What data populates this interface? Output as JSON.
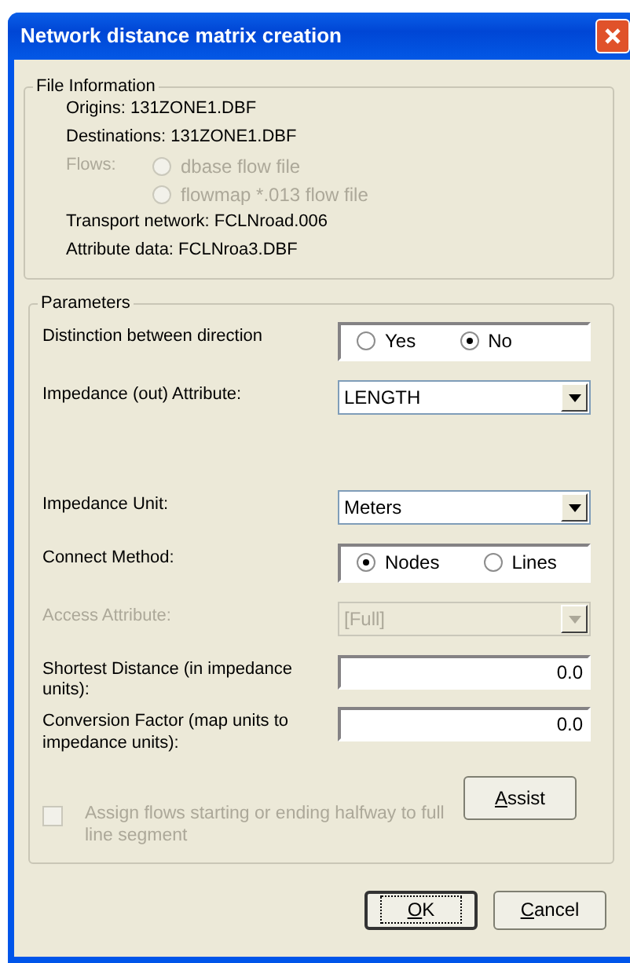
{
  "window": {
    "title": "Network distance matrix creation"
  },
  "file_information": {
    "legend": "File Information",
    "lines": [
      {
        "kind": "text",
        "text": "Origins: 131ZONE1.DBF"
      },
      {
        "kind": "text",
        "text": "Destinations: 131ZONE1.DBF"
      },
      {
        "kind": "radios",
        "label": "Flows:",
        "disabled": true,
        "options": [
          {
            "label": "dbase flow file",
            "selected": false
          },
          {
            "label": "flowmap *.013 flow file",
            "selected": false
          }
        ]
      },
      {
        "kind": "text",
        "text": "Transport network: FCLNroad.006"
      },
      {
        "kind": "text",
        "text": "Attribute data: FCLNroa3.DBF"
      }
    ]
  },
  "parameters": {
    "legend": "Parameters",
    "rows": [
      {
        "kind": "radio",
        "label": "Distinction between direction",
        "disabled": false,
        "options": [
          {
            "label": "Yes",
            "selected": false
          },
          {
            "label": "No",
            "selected": true
          }
        ]
      },
      {
        "kind": "select",
        "label": "Impedance (out) Attribute:",
        "value": "LENGTH",
        "disabled": false
      },
      {
        "kind": "select",
        "label": "Impedance Unit:",
        "value": "Meters",
        "disabled": false
      },
      {
        "kind": "radio",
        "label": "Connect Method:",
        "disabled": false,
        "options": [
          {
            "label": "Nodes",
            "selected": true
          },
          {
            "label": "Lines",
            "selected": false
          }
        ]
      },
      {
        "kind": "select",
        "label": "Access Attribute:",
        "value": "[Full]",
        "disabled": true
      },
      {
        "kind": "number",
        "label": "Shortest Distance (in impedance units):",
        "value": "0.0",
        "disabled": false
      },
      {
        "kind": "number",
        "label": "Conversion Factor (map units to impedance units):",
        "value": "0.0",
        "disabled": false
      }
    ],
    "checkbox": {
      "label": "Assign flows starting or ending halfway to full line segment",
      "checked": false,
      "disabled": true
    },
    "assist_button": {
      "accel": "A",
      "rest": "ssist"
    }
  },
  "buttons": [
    {
      "accel": "O",
      "rest": "K",
      "default": true
    },
    {
      "accel": "C",
      "rest": "ancel",
      "default": false
    }
  ]
}
